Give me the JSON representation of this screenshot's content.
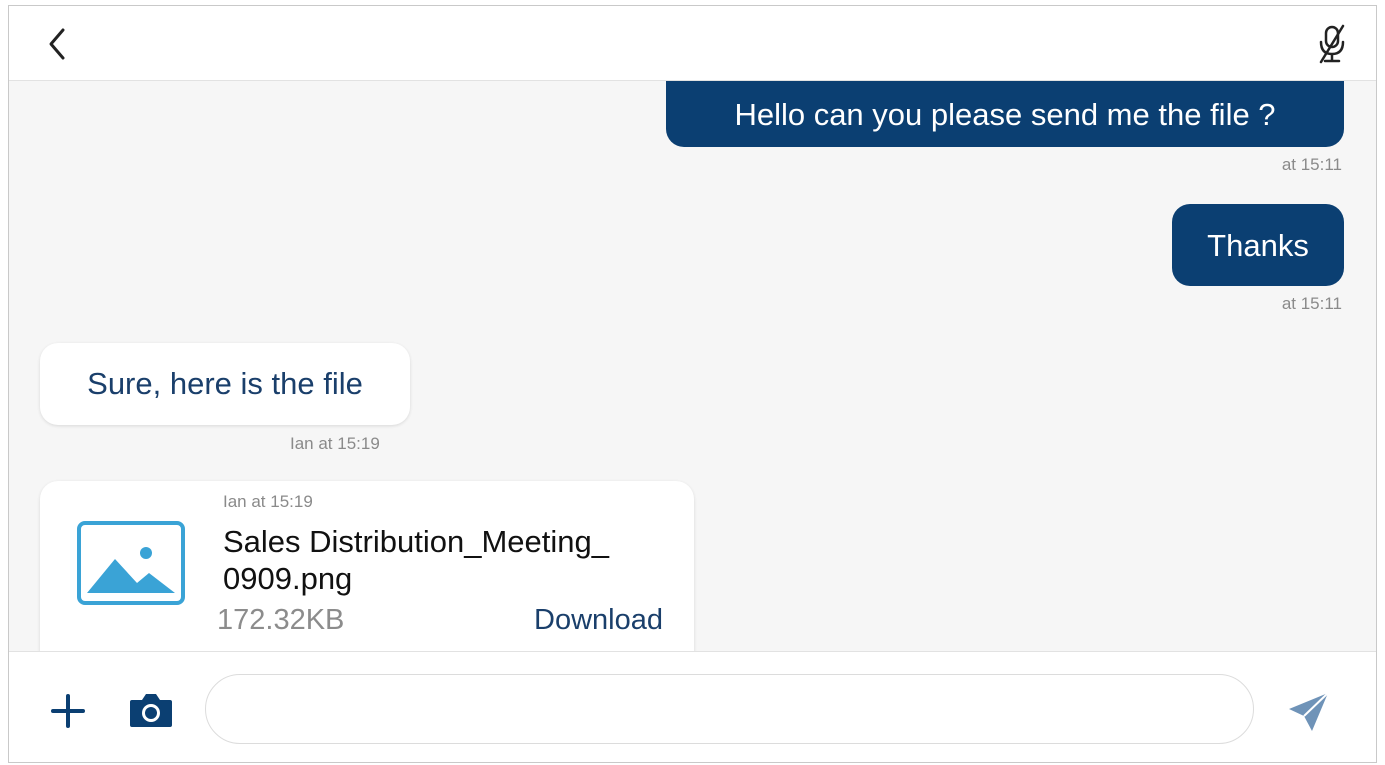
{
  "colors": {
    "accent": "#0b3f72",
    "incoming_text": "#1a3f6b",
    "timestamp": "#8a8a8a",
    "send_icon": "#6f93b8",
    "image_icon": "#3aa3d6"
  },
  "header": {
    "back_icon": "chevron-left-icon",
    "mute_icon": "mic-off-icon"
  },
  "messages": [
    {
      "direction": "outgoing",
      "text": "Hello can you please send me the file ?",
      "time": "at 15:11"
    },
    {
      "direction": "outgoing",
      "text": "Thanks",
      "time": "at 15:11"
    },
    {
      "direction": "incoming",
      "text": "Sure, here is the file",
      "time": "Ian at 15:19"
    }
  ],
  "file_message": {
    "sender_time": "Ian at 15:19",
    "file_name_line1": "Sales Distribution_Meeting_",
    "file_name_line2": "0909.png",
    "size": "172.32KB",
    "download_label": "Download",
    "thumb_icon": "image-icon"
  },
  "composer": {
    "input_value": "",
    "input_placeholder": "",
    "plus_icon": "plus-icon",
    "camera_icon": "camera-icon",
    "send_icon": "send-icon"
  }
}
